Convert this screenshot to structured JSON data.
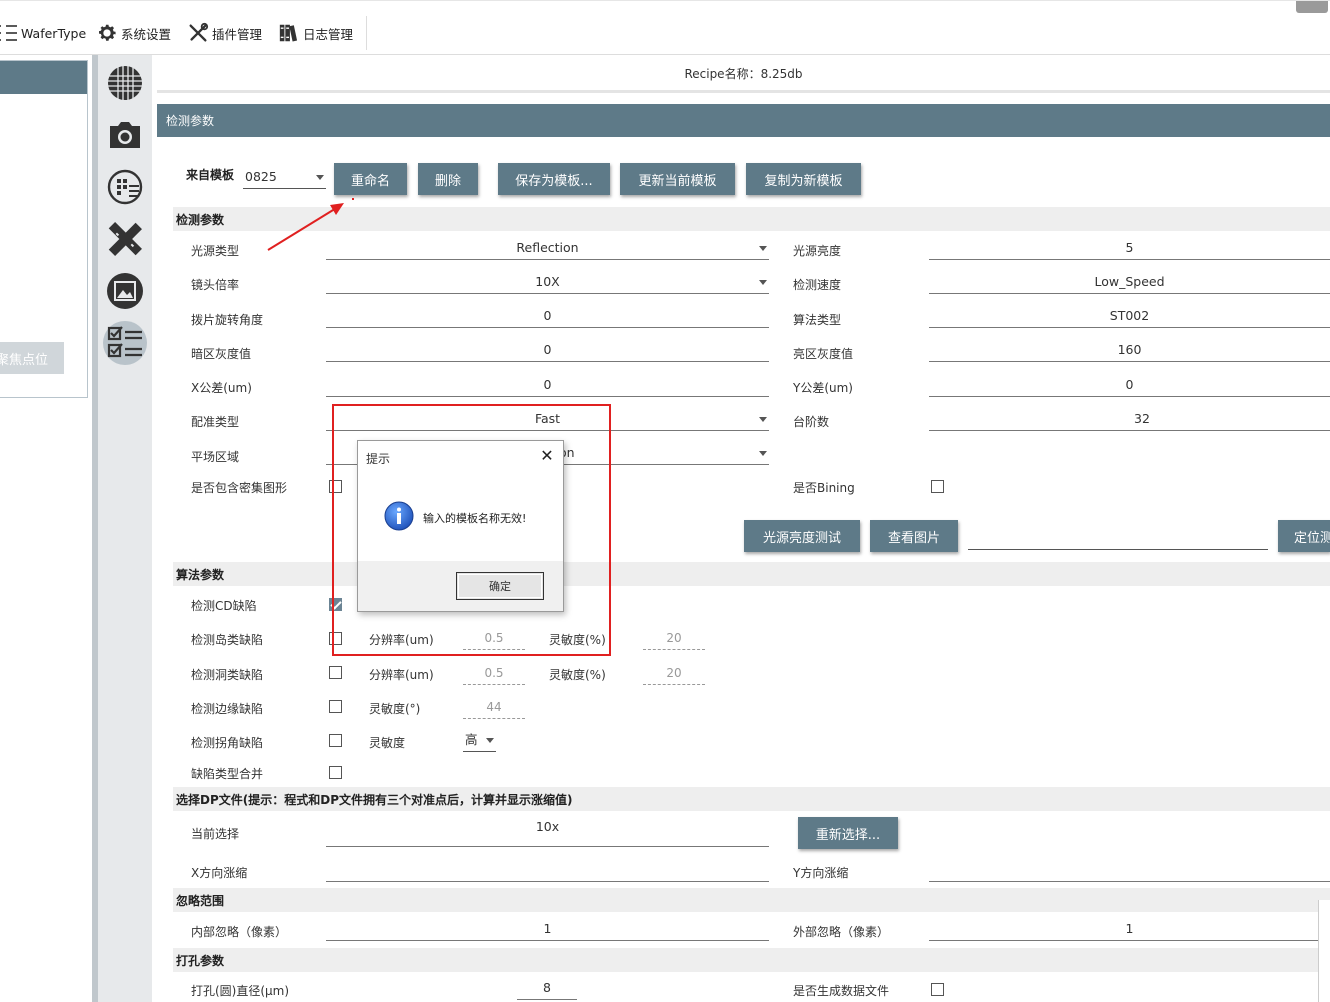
{
  "menu": {
    "items": [
      {
        "label": "WaferType",
        "icon": "list-icon"
      },
      {
        "label": "系统设置",
        "icon": "gear-icon"
      },
      {
        "label": "插件管理",
        "icon": "tools-icon"
      },
      {
        "label": "日志管理",
        "icon": "books-icon"
      }
    ]
  },
  "left_panel": {
    "focus_button": "聚焦点位"
  },
  "toolbar": [
    "wafer-map-icon",
    "camera-icon",
    "wafer-scan-icon",
    "ruler-icon",
    "image-frame-icon",
    "checklist-icon"
  ],
  "recipe": {
    "title": "Recipe名称：8.25db"
  },
  "panel": {
    "header": "检测参数"
  },
  "template": {
    "label": "来自模板",
    "value": "0825",
    "buttons": {
      "rename": "重命名",
      "delete": "删除",
      "save_as": "保存为模板...",
      "update": "更新当前模板",
      "copy_new": "复制为新模板"
    }
  },
  "detect": {
    "section": "检测参数",
    "light_source_type": {
      "label": "光源类型",
      "value": "Reflection"
    },
    "light_brightness": {
      "label": "光源亮度",
      "value": "5"
    },
    "lens_mag": {
      "label": "镜头倍率",
      "value": "10X"
    },
    "detect_speed": {
      "label": "检测速度",
      "value": "Low_Speed"
    },
    "rotate_angle": {
      "label": "拨片旋转角度",
      "value": "0"
    },
    "algo_type": {
      "label": "算法类型",
      "value": "ST002"
    },
    "dark_gray": {
      "label": "暗区灰度值",
      "value": "0"
    },
    "bright_gray": {
      "label": "亮区灰度值",
      "value": "160"
    },
    "x_tol": {
      "label": "X公差(um)",
      "value": "0"
    },
    "y_tol": {
      "label": "Y公差(um)",
      "value": "0"
    },
    "align_type": {
      "label": "配准类型",
      "value": "Fast"
    },
    "steps": {
      "label": "台阶数",
      "value": "32"
    },
    "flat_region": {
      "label": "平场区域",
      "value": "on"
    },
    "dense_pattern": {
      "label": "是否包含密集图形"
    },
    "bining": {
      "label": "是否Bining"
    },
    "btn_light_test": "光源亮度测试",
    "btn_view_image": "查看图片",
    "btn_locate": "定位测"
  },
  "algo": {
    "section": "算法参数",
    "cd_defect": {
      "label": "检测CD缺陷"
    },
    "island_defect": {
      "label": "检测岛类缺陷",
      "res_label": "分辨率(um)",
      "res": "0.5",
      "sens_label": "灵敏度(%)",
      "sens": "20"
    },
    "hole_defect": {
      "label": "检测洞类缺陷",
      "res_label": "分辨率(um)",
      "res": "0.5",
      "sens_label": "灵敏度(%)",
      "sens": "20"
    },
    "edge_defect": {
      "label": "检测边缘缺陷",
      "sens_label": "灵敏度(°)",
      "sens": "44"
    },
    "corner_defect": {
      "label": "检测拐角缺陷",
      "sens_label": "灵敏度",
      "sens": "高"
    },
    "merge_types": {
      "label": "缺陷类型合并"
    }
  },
  "dp": {
    "section": "选择DP文件(提示：程式和DP文件拥有三个对准点后，计算并显示涨缩值)",
    "current": {
      "label": "当前选择",
      "value": "10x"
    },
    "reselect": "重新选择...",
    "x_scale": {
      "label": "X方向涨缩",
      "value": ""
    },
    "y_scale": {
      "label": "Y方向涨缩",
      "value": ""
    }
  },
  "ignore": {
    "section": "忽略范围",
    "inner": {
      "label": "内部忽略（像素）",
      "value": "1"
    },
    "outer": {
      "label": "外部忽略（像素）",
      "value": "1"
    }
  },
  "punch": {
    "section": "打孔参数",
    "diameter": {
      "label": "打孔(圆)直径(μm)",
      "value": "8"
    },
    "gen_data": {
      "label": "是否生成数据文件"
    }
  },
  "dialog": {
    "title": "提示",
    "message": "输入的模板名称无效!",
    "ok": "确定"
  },
  "colors": {
    "accent": "#5e7a88",
    "annotation": "#e02020"
  }
}
